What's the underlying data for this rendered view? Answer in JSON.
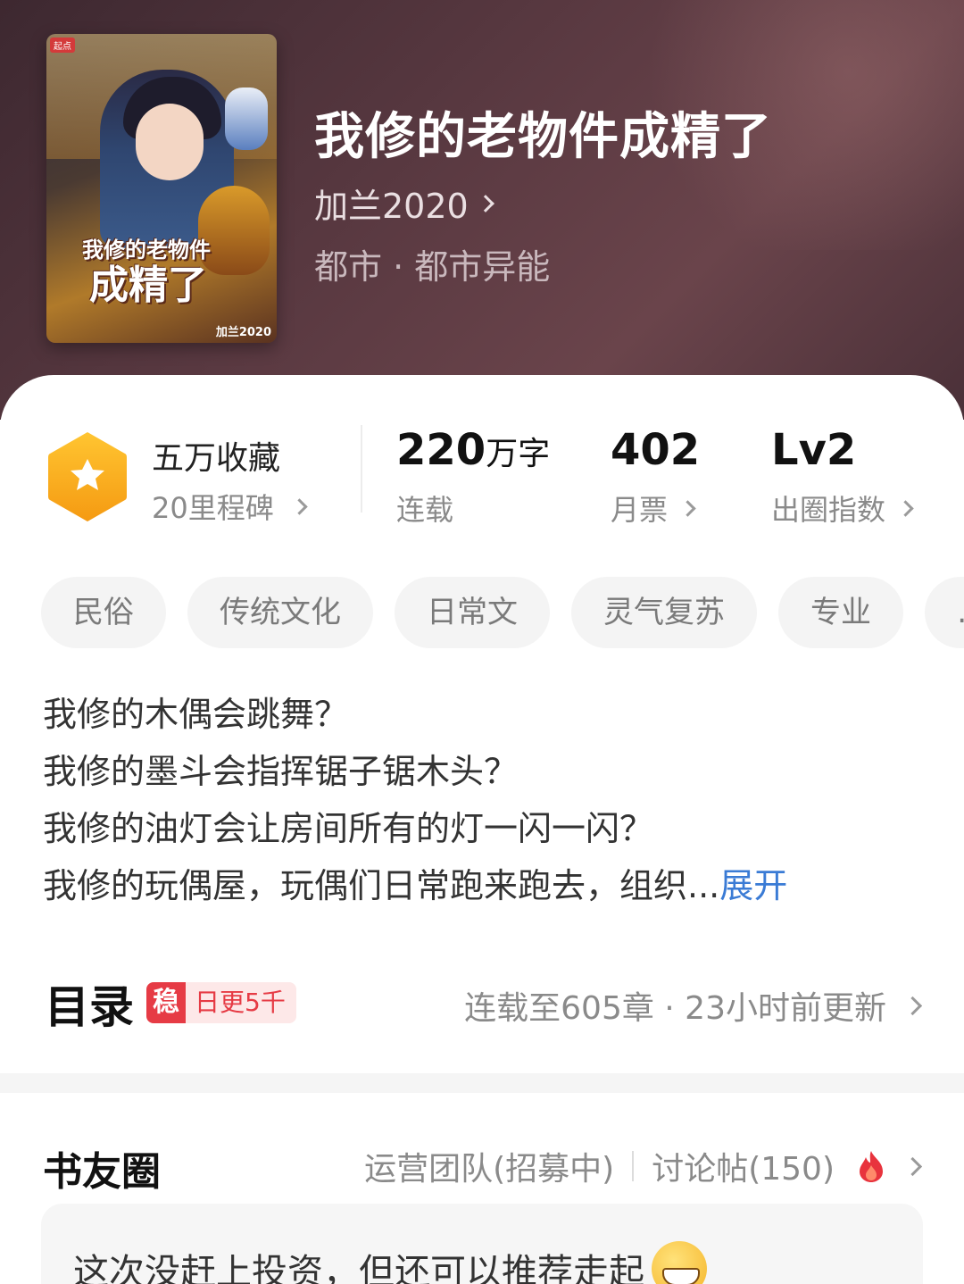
{
  "book": {
    "title": "我修的老物件成精了",
    "author": "加兰2020",
    "genre": "都市 · 都市异能",
    "cover": {
      "title_line1": "我修的老物件",
      "title_line2": "成精了",
      "author": "加兰2020",
      "badge": "起点"
    }
  },
  "stats": {
    "collect_title": "五万收藏",
    "collect_sub": "20里程碑",
    "words_value": "220",
    "words_unit": "万字",
    "words_label": "连载",
    "votes_value": "402",
    "votes_label": "月票",
    "level_value": "Lv2",
    "level_label": "出圈指数"
  },
  "tags": [
    "民俗",
    "传统文化",
    "日常文",
    "灵气复苏",
    "专业",
    "…"
  ],
  "description": {
    "lines": [
      "我修的木偶会跳舞？",
      "我修的墨斗会指挥锯子锯木头？",
      "我修的油灯会让房间所有的灯一闪一闪？",
      "我修的玩偶屋，玩偶们日常跑来跑去，组织..."
    ],
    "expand_label": "展开"
  },
  "toc": {
    "title": "目录",
    "stable_badge": "稳",
    "daily_badge": "日更5千",
    "status": "连载至605章 · 23小时前更新"
  },
  "circle": {
    "title": "书友圈",
    "ops_link": "运营团队(招募中)",
    "discuss_link": "讨论帖(150)",
    "post_text": "这次没赶上投资，但还可以推荐走起"
  },
  "colors": {
    "header_bg": "#5b3a42",
    "accent_red": "#e63b45",
    "link_blue": "#3a7bd5",
    "badge_orange": "#f7a21b"
  },
  "icons": [
    "star-badge-icon",
    "chevron-right-icon",
    "fire-icon",
    "grin-emoji-icon"
  ]
}
